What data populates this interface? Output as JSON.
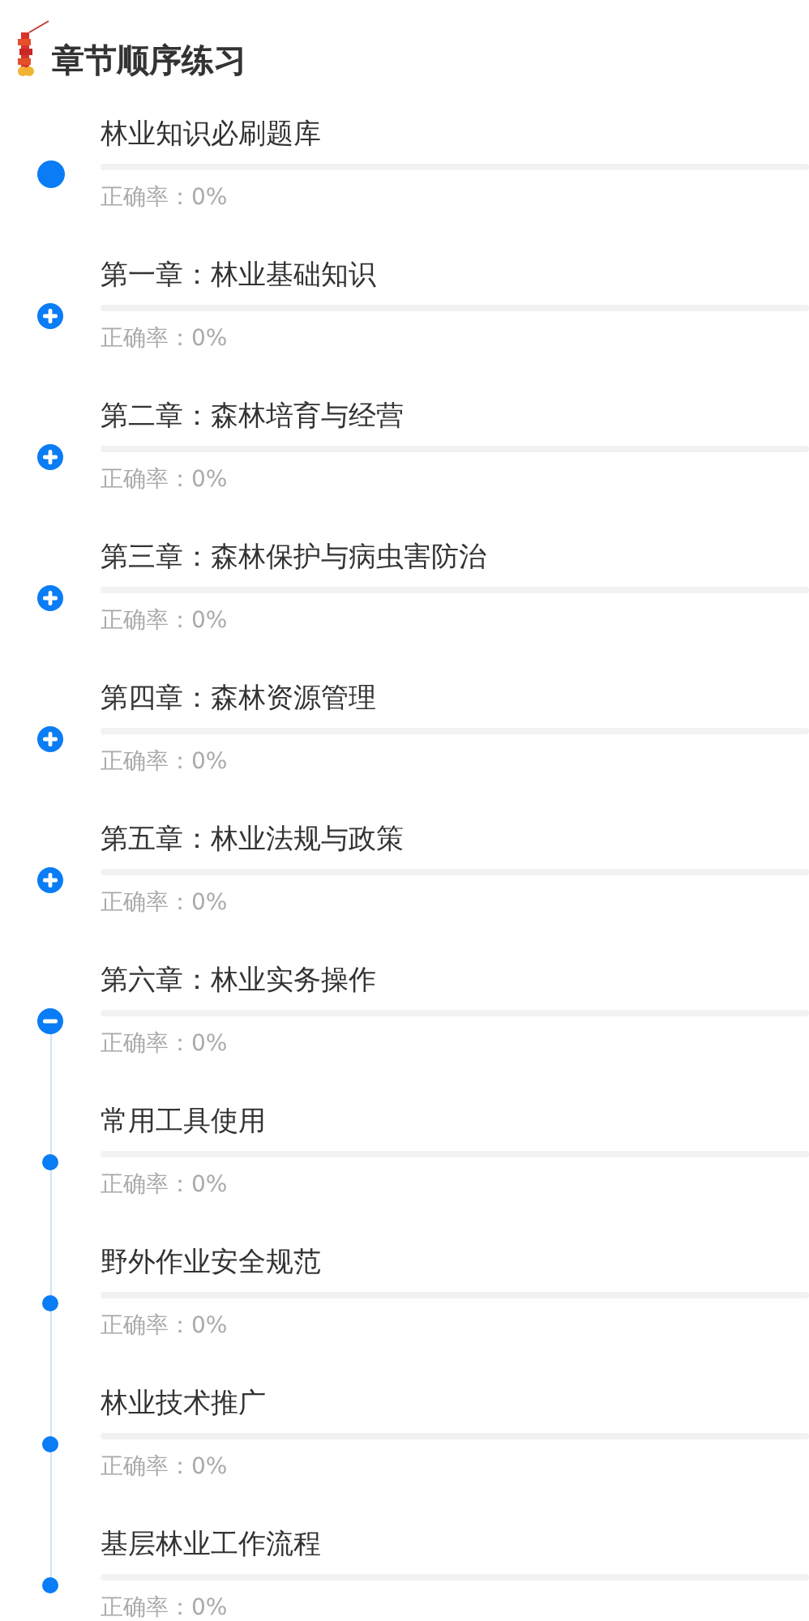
{
  "header": {
    "title": "章节顺序练习"
  },
  "chapters": [
    {
      "kind": "bank",
      "title": "林业知识必刷题库",
      "level": 0,
      "accuracy": "正确率：0%"
    },
    {
      "kind": "chapter",
      "expanded": false,
      "title": "第一章：林业基础知识",
      "level": 0,
      "accuracy": "正确率：0%"
    },
    {
      "kind": "chapter",
      "expanded": false,
      "title": "第二章：森林培育与经营",
      "level": 0,
      "accuracy": "正确率：0%"
    },
    {
      "kind": "chapter",
      "expanded": false,
      "title": "第三章：森林保护与病虫害防治",
      "level": 0,
      "accuracy": "正确率：0%"
    },
    {
      "kind": "chapter",
      "expanded": false,
      "title": "第四章：森林资源管理",
      "level": 0,
      "accuracy": "正确率：0%"
    },
    {
      "kind": "chapter",
      "expanded": false,
      "title": "第五章：林业法规与政策",
      "level": 0,
      "accuracy": "正确率：0%"
    },
    {
      "kind": "chapter",
      "expanded": true,
      "title": "第六章：林业实务操作",
      "level": 0,
      "accuracy": "正确率：0%",
      "children": [
        {
          "title": "常用工具使用",
          "level": 0,
          "accuracy": "正确率：0%"
        },
        {
          "title": "野外作业安全规范",
          "level": 0,
          "accuracy": "正确率：0%"
        },
        {
          "title": "林业技术推广",
          "level": 0,
          "accuracy": "正确率：0%"
        },
        {
          "title": "基层林业工作流程",
          "level": 0,
          "accuracy": "正确率：0%"
        }
      ]
    }
  ]
}
